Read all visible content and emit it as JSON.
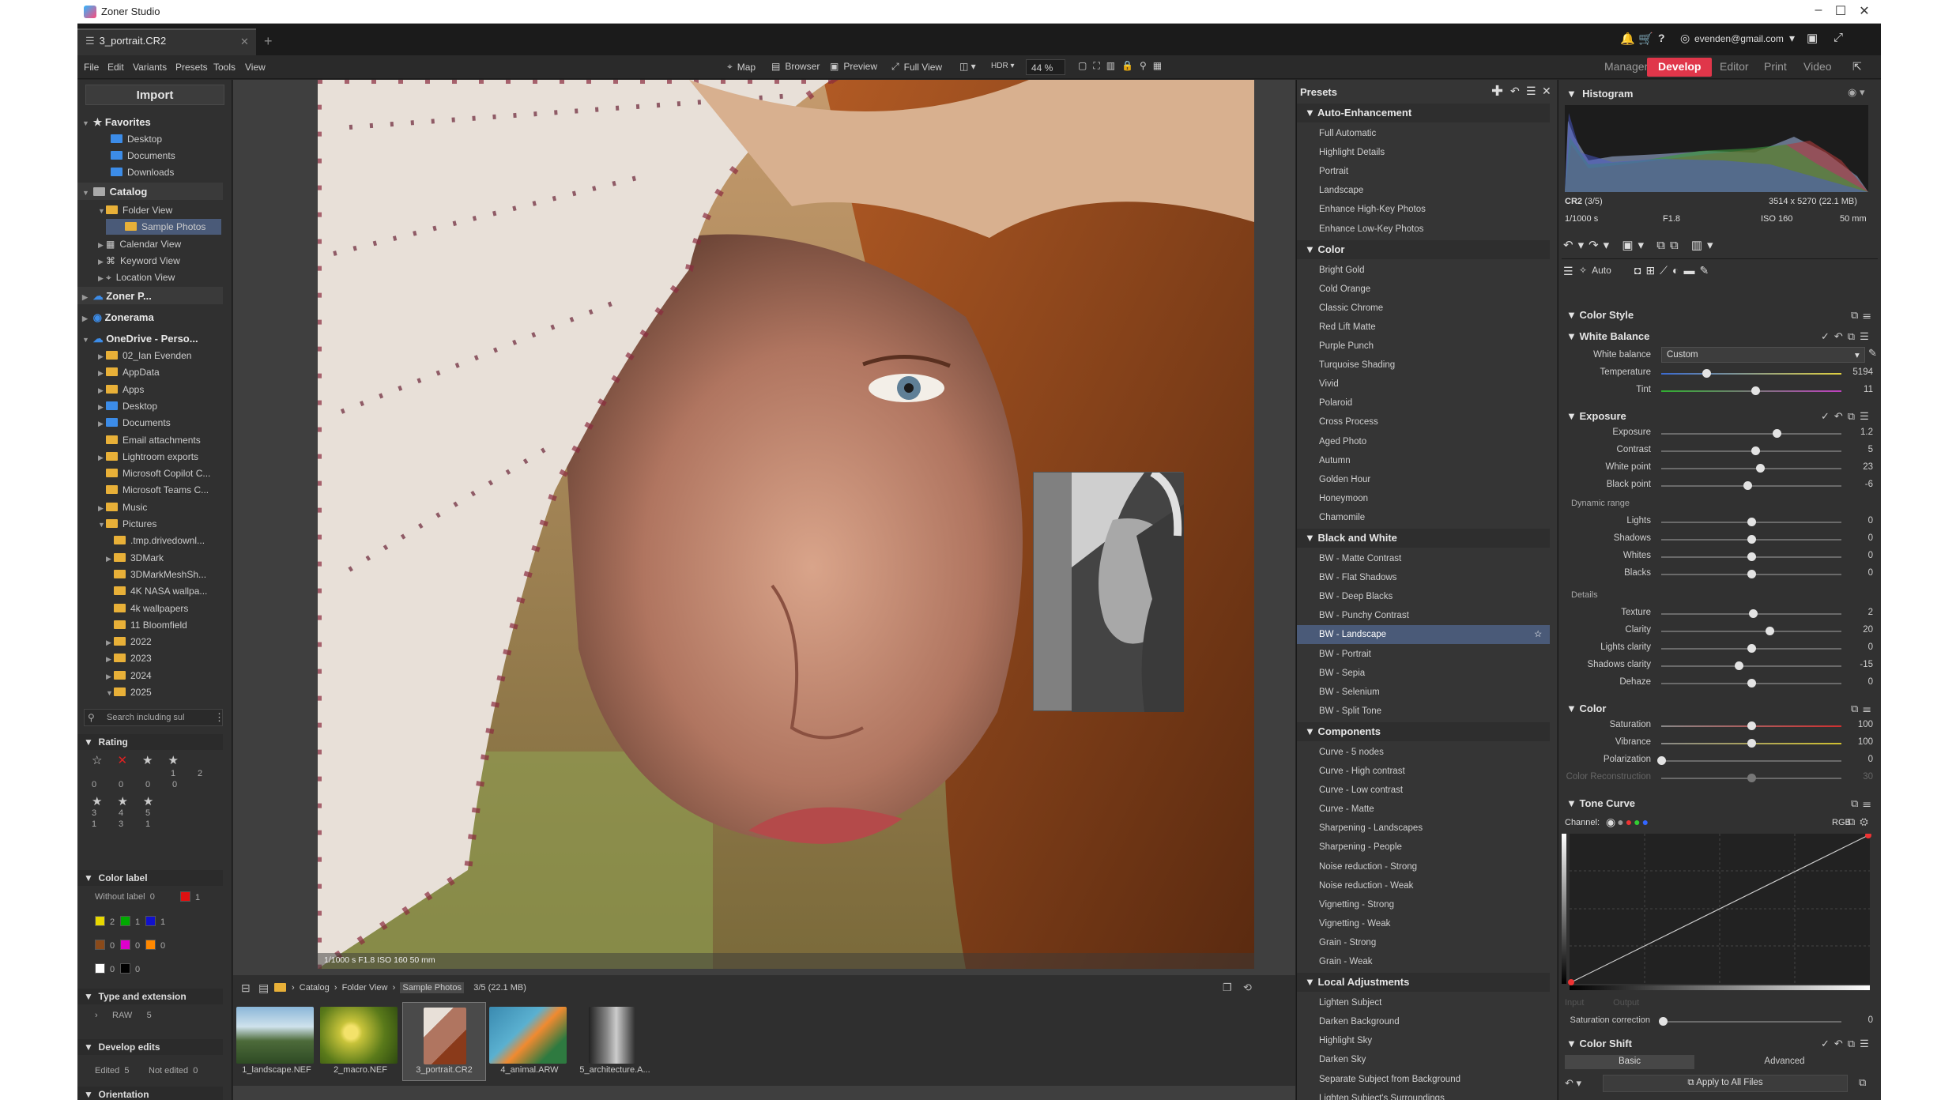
{
  "window": {
    "title": "Zoner Studio",
    "minimize": "–",
    "maximize": "☐",
    "close": "✕"
  },
  "tab": {
    "name": "3_portrait.CR2",
    "add": "+"
  },
  "account": {
    "email": "evenden@gmail.com"
  },
  "menu": [
    "File",
    "Edit",
    "Variants",
    "Presets",
    "Tools",
    "View"
  ],
  "toolbar": {
    "map": "Map",
    "browser": "Browser",
    "preview": "Preview",
    "fullview": "Full View",
    "zoom": "44 %"
  },
  "modes": [
    {
      "label": "Manager",
      "active": false
    },
    {
      "label": "Develop",
      "active": true
    },
    {
      "label": "Editor",
      "active": false
    },
    {
      "label": "Print",
      "active": false
    },
    {
      "label": "Video",
      "active": false
    }
  ],
  "left": {
    "import": "Import",
    "favorites": {
      "title": "Favorites",
      "items": [
        "Desktop",
        "Documents",
        "Downloads"
      ]
    },
    "catalog": {
      "title": "Catalog",
      "items": [
        {
          "label": "Folder View"
        },
        {
          "label": "Sample Photos"
        },
        {
          "label": "Calendar View"
        },
        {
          "label": "Keyword View"
        },
        {
          "label": "Location View"
        }
      ]
    },
    "zonerp": "Zoner P...",
    "zonerama": "Zonerama",
    "onedrive": {
      "title": "OneDrive - Perso...",
      "items": [
        "02_Ian Evenden",
        "AppData",
        "Apps",
        "Desktop",
        "Documents",
        "Email attachments",
        "Lightroom exports",
        "Microsoft Copilot C...",
        "Microsoft Teams C...",
        "Music",
        "Pictures",
        ".tmp.drivedownl...",
        "3DMark",
        "3DMarkMeshSh...",
        "4K NASA wallpa...",
        "4k wallpapers",
        "11 Bloomfield",
        "2022",
        "2023",
        "2024",
        "2025"
      ]
    },
    "search_placeholder": "Search including sul",
    "rating": {
      "title": "Rating",
      "row1_counts": [
        "0",
        "0",
        "0",
        "0"
      ],
      "row1_labels": [
        "",
        "",
        "1",
        "2"
      ],
      "row2_labels": [
        "3",
        "4",
        "5"
      ],
      "row2_counts": [
        "1",
        "3",
        "1"
      ]
    },
    "colorlabel": {
      "title": "Color label",
      "without": "Without label",
      "without_count": "0",
      "red": "1",
      "yellow": "2",
      "green": "1",
      "blue": "1",
      "brown": "0",
      "magenta": "0",
      "orange": "0",
      "white": "0",
      "black": "0"
    },
    "typeext": {
      "title": "Type and extension",
      "raw": "RAW",
      "raw_count": "5"
    },
    "developedits": {
      "title": "Develop edits",
      "edited": "Edited",
      "edited_count": "5",
      "notedited": "Not edited",
      "notedited_count": "0"
    },
    "orientation": "Orientation"
  },
  "photo": {
    "info": "1/1000 s   F1.8   ISO 160   50 mm"
  },
  "filmstrip": {
    "path": [
      "Catalog",
      "Folder View",
      "Sample Photos"
    ],
    "count": "3/5 (22.1 MB)",
    "thumbs": [
      "1_landscape.NEF",
      "2_macro.NEF",
      "3_portrait.CR2",
      "4_animal.ARW",
      "5_architecture.A..."
    ]
  },
  "presets": {
    "title": "Presets",
    "categories": [
      {
        "name": "Auto-Enhancement",
        "items": [
          "Full Automatic",
          "Highlight Details",
          "Portrait",
          "Landscape",
          "Enhance High-Key Photos",
          "Enhance Low-Key Photos"
        ]
      },
      {
        "name": "Color",
        "items": [
          "Bright Gold",
          "Cold Orange",
          "Classic Chrome",
          "Red Lift Matte",
          "Purple Punch",
          "Turquoise Shading",
          "Vivid",
          "Polaroid",
          "Cross Process",
          "Aged Photo",
          "Autumn",
          "Golden Hour",
          "Honeymoon",
          "Chamomile"
        ]
      },
      {
        "name": "Black and White",
        "items": [
          "BW - Matte Contrast",
          "BW - Flat Shadows",
          "BW - Deep Blacks",
          "BW - Punchy Contrast",
          "BW - Landscape",
          "BW - Portrait",
          "BW - Sepia",
          "BW - Selenium",
          "BW - Split Tone"
        ]
      },
      {
        "name": "Components",
        "items": [
          "Curve - 5 nodes",
          "Curve - High contrast",
          "Curve - Low contrast",
          "Curve - Matte",
          "Sharpening - Landscapes",
          "Sharpening - People",
          "Noise reduction - Strong",
          "Noise reduction - Weak",
          "Vignetting - Strong",
          "Vignetting - Weak",
          "Grain - Strong",
          "Grain - Weak"
        ]
      },
      {
        "name": "Local Adjustments",
        "items": [
          "Lighten Subject",
          "Darken Background",
          "Highlight Sky",
          "Darken Sky",
          "Separate Subject from Background",
          "Lighten Subject's Surroundings"
        ]
      }
    ]
  },
  "right": {
    "histogram": "Histogram",
    "fileinfo": {
      "name": "CR2",
      "index": "(3/5)",
      "dims": "3514 x 5270 (22.1 MB)",
      "shutter": "1/1000 s",
      "aperture": "F1.8",
      "iso": "ISO 160",
      "focal": "50 mm"
    },
    "auto": "Auto",
    "colorstyle": "Color Style",
    "whitebalance": {
      "title": "White Balance",
      "label": "White balance",
      "value": "Custom"
    },
    "sliders": {
      "temperature": {
        "label": "Temperature",
        "value": "5194",
        "pos": 0.25
      },
      "tint": {
        "label": "Tint",
        "value": "11",
        "pos": 0.52
      },
      "exposure_title": "Exposure",
      "exposure": {
        "label": "Exposure",
        "value": "1.2",
        "pos": 0.64
      },
      "contrast": {
        "label": "Contrast",
        "value": "5",
        "pos": 0.52
      },
      "whitepoint": {
        "label": "White point",
        "value": "23",
        "pos": 0.55
      },
      "blackpoint": {
        "label": "Black point",
        "value": "-6",
        "pos": 0.48
      },
      "dynamic_range": "Dynamic range",
      "lights": {
        "label": "Lights",
        "value": "0",
        "pos": 0.5
      },
      "shadows": {
        "label": "Shadows",
        "value": "0",
        "pos": 0.5
      },
      "whites": {
        "label": "Whites",
        "value": "0",
        "pos": 0.5
      },
      "blacks": {
        "label": "Blacks",
        "value": "0",
        "pos": 0.5
      },
      "details": "Details",
      "texture": {
        "label": "Texture",
        "value": "2",
        "pos": 0.51
      },
      "clarity": {
        "label": "Clarity",
        "value": "20",
        "pos": 0.6
      },
      "lightsclarity": {
        "label": "Lights clarity",
        "value": "0",
        "pos": 0.5
      },
      "shadowsclarity": {
        "label": "Shadows clarity",
        "value": "-15",
        "pos": 0.43
      },
      "dehaze": {
        "label": "Dehaze",
        "value": "0",
        "pos": 0.5
      },
      "color_title": "Color",
      "saturation": {
        "label": "Saturation",
        "value": "100",
        "pos": 0.5
      },
      "vibrance": {
        "label": "Vibrance",
        "value": "100",
        "pos": 0.5
      },
      "polarization": {
        "label": "Polarization",
        "value": "0",
        "pos": 0.0
      },
      "colorrecon": {
        "label": "Color Reconstruction",
        "value": "30",
        "pos": 0.5
      }
    },
    "tonecurve": {
      "title": "Tone Curve",
      "channel": "Channel:",
      "rgb": "RGB",
      "input": "Input",
      "output": "Output",
      "satcorr": "Saturation correction",
      "satcorr_value": "0"
    },
    "colorshift": {
      "title": "Color Shift",
      "basic": "Basic",
      "advanced": "Advanced"
    },
    "apply": "Apply to All Files"
  }
}
